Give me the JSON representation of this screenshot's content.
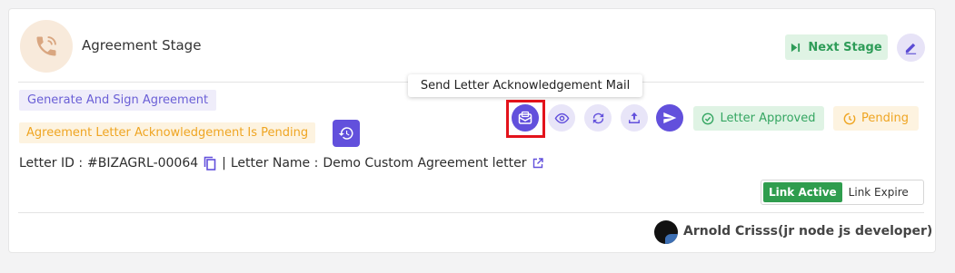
{
  "stage": {
    "title": "Agreement Stage",
    "next_stage_label": "Next Stage"
  },
  "tags": {
    "generate_sign": "Generate And Sign Agreement",
    "ack_pending": "Agreement Letter Acknowledgement Is Pending"
  },
  "tooltip": {
    "text": "Send Letter Acknowledgement Mail"
  },
  "status": {
    "approved_label": "Letter Approved",
    "pending_label": "Pending"
  },
  "letter": {
    "id_label": "Letter ID :",
    "id_value": "#BIZAGRL-00064",
    "separator": "|",
    "name_label": "Letter Name :",
    "name_value": "Demo Custom Agreement letter"
  },
  "link": {
    "active_label": "Link Active",
    "expire_label": "Link Expire"
  },
  "user": {
    "name": "Arnold Crisss(jr node js developer)"
  },
  "colors": {
    "accent": "#6250dc",
    "success": "#35a662",
    "warning": "#efa522",
    "highlight": "#e3131b"
  },
  "icons": [
    "phone-icon",
    "next-stage-icon",
    "edit-icon",
    "history-icon",
    "mail-icon",
    "eye-icon",
    "refresh-icon",
    "upload-icon",
    "send-icon",
    "check-circle-icon",
    "pending-clock-icon",
    "copy-icon",
    "external-link-icon"
  ]
}
